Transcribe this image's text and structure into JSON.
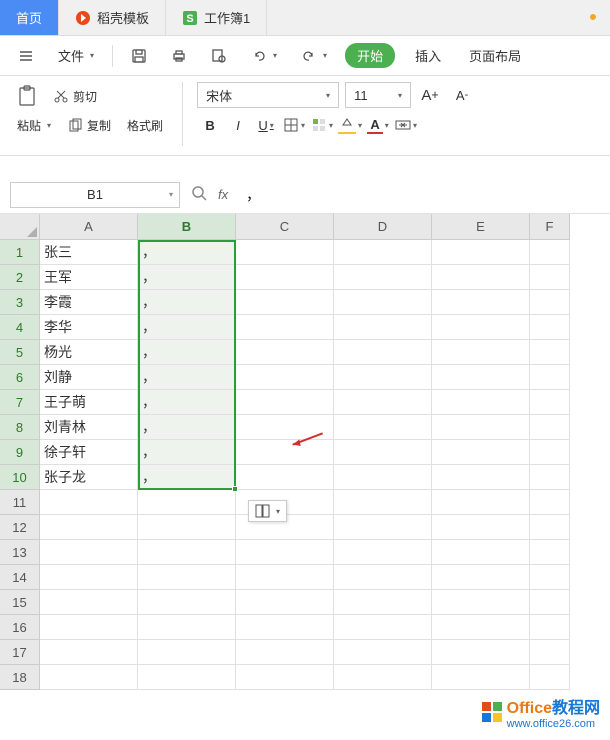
{
  "tabs": {
    "home": "首页",
    "docer": "稻壳模板",
    "workbook": "工作簿1"
  },
  "menubar": {
    "file": "文件",
    "start": "开始",
    "insert": "插入",
    "pagelayout": "页面布局"
  },
  "toolbar": {
    "cut": "剪切",
    "copy": "复制",
    "paste": "粘贴",
    "formatpainter": "格式刷",
    "font_name": "宋体",
    "font_size": "11"
  },
  "namebox": "B1",
  "formula_value": "，",
  "columns": [
    "A",
    "B",
    "C",
    "D",
    "E",
    "F"
  ],
  "rows": [
    {
      "n": "1",
      "a": "张三",
      "b": "，"
    },
    {
      "n": "2",
      "a": "王军",
      "b": "，"
    },
    {
      "n": "3",
      "a": "李霞",
      "b": "，"
    },
    {
      "n": "4",
      "a": "李华",
      "b": "，"
    },
    {
      "n": "5",
      "a": "杨光",
      "b": "，"
    },
    {
      "n": "6",
      "a": "刘静",
      "b": "，"
    },
    {
      "n": "7",
      "a": "王子萌",
      "b": "，"
    },
    {
      "n": "8",
      "a": "刘青林",
      "b": "，"
    },
    {
      "n": "9",
      "a": "徐子轩",
      "b": "，"
    },
    {
      "n": "10",
      "a": "张子龙",
      "b": "，"
    },
    {
      "n": "11",
      "a": "",
      "b": ""
    },
    {
      "n": "12",
      "a": "",
      "b": ""
    },
    {
      "n": "13",
      "a": "",
      "b": ""
    },
    {
      "n": "14",
      "a": "",
      "b": ""
    },
    {
      "n": "15",
      "a": "",
      "b": ""
    },
    {
      "n": "16",
      "a": "",
      "b": ""
    },
    {
      "n": "17",
      "a": "",
      "b": ""
    },
    {
      "n": "18",
      "a": "",
      "b": ""
    }
  ],
  "watermark": {
    "brand1": "Office",
    "brand2": "教程网",
    "url": "www.office26.com"
  }
}
